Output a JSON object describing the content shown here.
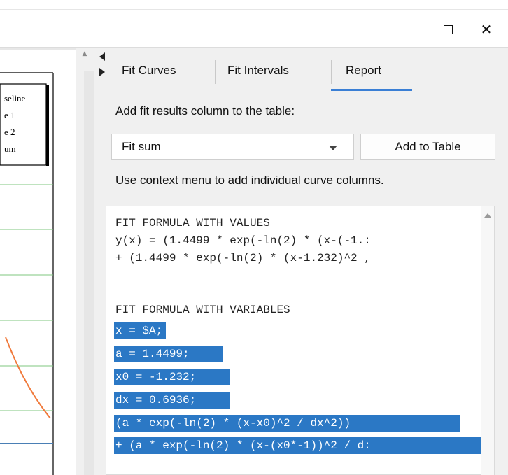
{
  "window": {
    "maximize_label": "",
    "close_glyph": "✕"
  },
  "graph": {
    "legend_items": [
      "seline",
      "e 1",
      "e 2",
      "um"
    ],
    "colors": {
      "grid": "#7fc77f",
      "curve": "#f07a3c",
      "baseline": "#4a7fb5"
    }
  },
  "panel": {
    "tabs": [
      {
        "label": "Fit Curves"
      },
      {
        "label": "Fit Intervals"
      },
      {
        "label": "Report"
      }
    ],
    "active_tab": "Report",
    "add_fit_label": "Add fit results column to the table:",
    "fit_select": {
      "value": "Fit sum"
    },
    "add_table_button": "Add to Table",
    "context_hint": "Use context menu to add individual curve columns.",
    "report_lines": [
      {
        "text": "FIT FORMULA WITH VALUES",
        "selected": false
      },
      {
        "text": "y(x) = (1.4499 * exp(-ln(2) * (x-(-1.:",
        "selected": false
      },
      {
        "text": "+ (1.4499 * exp(-ln(2) * (x-1.232)^2 ,",
        "selected": false
      },
      {
        "text": "",
        "selected": false
      },
      {
        "text": "FIT FORMULA WITH VARIABLES",
        "selected": false
      },
      {
        "text": "x = $A;",
        "selected": true
      },
      {
        "text": "a = 1.4499;",
        "selected": true
      },
      {
        "text": "x0 = -1.232;",
        "selected": true
      },
      {
        "text": "dx = 0.6936;",
        "selected": true
      },
      {
        "text": "(a * exp(-ln(2) * (x-x0)^2 / dx^2))",
        "selected": true
      },
      {
        "text": "+ (a * exp(-ln(2) * (x-(x0*-1))^2 / d:",
        "selected": true
      }
    ],
    "accent_color": "#3a7fd5",
    "selection_color": "#2b78c5"
  }
}
